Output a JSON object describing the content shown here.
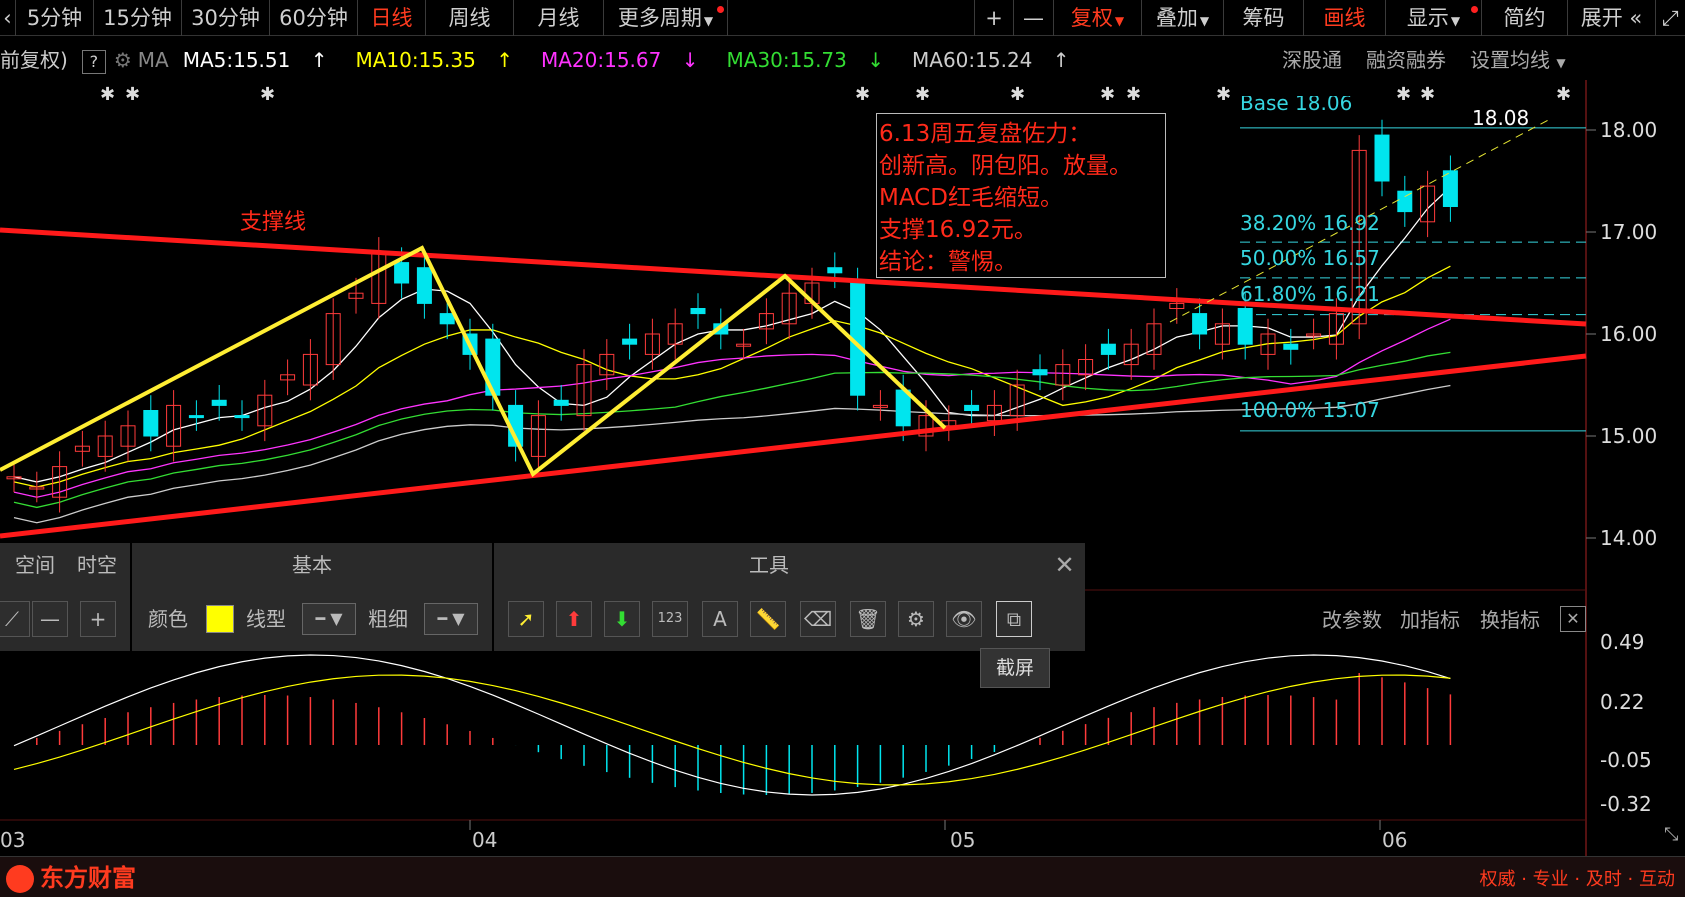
{
  "toolbar": {
    "periods": [
      {
        "label": "5分钟"
      },
      {
        "label": "15分钟"
      },
      {
        "label": "30分钟"
      },
      {
        "label": "60分钟"
      },
      {
        "label": "日线"
      },
      {
        "label": "周线"
      },
      {
        "label": "月线"
      },
      {
        "label": "更多周期"
      }
    ],
    "right": [
      {
        "label": "+"
      },
      {
        "label": "—"
      },
      {
        "label": "复权"
      },
      {
        "label": "叠加"
      },
      {
        "label": "筹码"
      },
      {
        "label": "画线"
      },
      {
        "label": "显示"
      },
      {
        "label": "简约"
      },
      {
        "label": "展开"
      }
    ]
  },
  "ma_bar": {
    "prefix": "前复权)",
    "help": "?",
    "ma_label": "MA",
    "ma5": "MA5:15.51",
    "ma10": "MA10:15.35",
    "ma20": "MA20:15.67",
    "ma30": "MA30:15.73",
    "ma60": "MA60:15.24",
    "links": [
      "深股通",
      "融资融券",
      "设置均线"
    ]
  },
  "colors": {
    "ma5": "#ffffff",
    "ma10": "#ffff00",
    "ma20": "#ff33ff",
    "ma30": "#33dd33",
    "ma60": "#cccccc",
    "up": "#ff3b3b",
    "down": "#00e5ee",
    "trend": "#ff1a1a",
    "zigzag": "#ffee33"
  },
  "y_labels": [
    "18.00",
    "17.00",
    "16.00",
    "15.00",
    "14.00"
  ],
  "annotation": {
    "lines": [
      "6.13周五复盘佐力：",
      "创新高。阴包阳。放量。",
      "MACD红毛缩短。",
      "支撑16.92元。",
      "结论：警惕。"
    ]
  },
  "support_label": "支撑线",
  "fib": {
    "base": "Base  18.06",
    "high": "18.08",
    "l382": "38.20% 16.92",
    "l500": "50.00% 16.57",
    "l618": "61.80% 16.21",
    "l100": "100.0% 15.07"
  },
  "tool_panel": {
    "sec1": [
      "空间",
      "时空"
    ],
    "sec2_title": "基本",
    "color_label": "颜色",
    "linetype_label": "线型",
    "thickness_label": "粗细",
    "sec3_title": "工具",
    "tooltip": "截屏"
  },
  "indicator_bar": [
    "改参数",
    "加指标",
    "换指标"
  ],
  "macd_labels": [
    "0.49",
    "0.22",
    "-0.05",
    "-0.32"
  ],
  "x_labels": [
    "03",
    "04",
    "05",
    "06"
  ],
  "footer": {
    "logo": "东方财富",
    "slogan": "权威 · 专业 · 及时 · 互动"
  }
}
